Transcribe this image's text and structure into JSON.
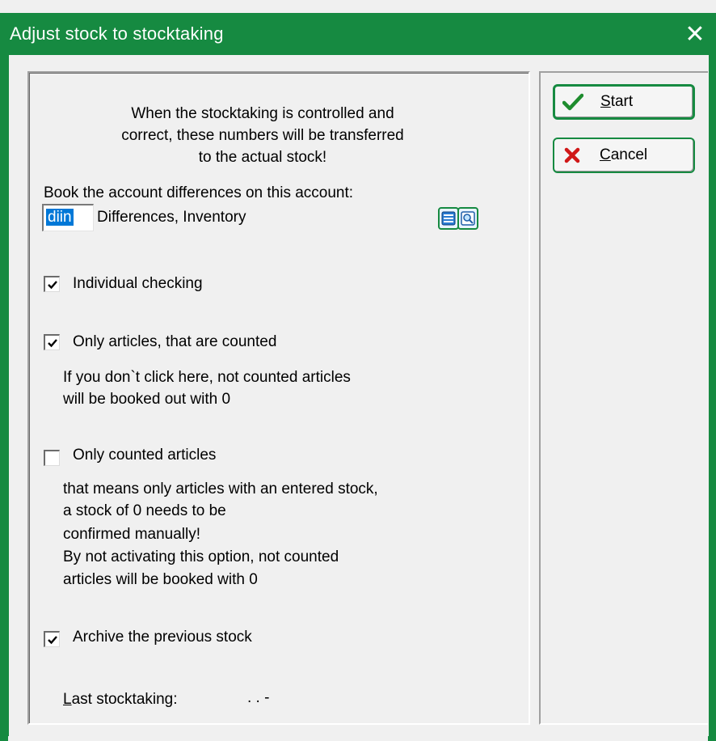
{
  "window": {
    "title": "Adjust stock to stocktaking",
    "close_glyph": "✕"
  },
  "intro": {
    "line1": "When the stocktaking is controlled and",
    "line2": "correct, these numbers will be transferred",
    "line3": "to the actual stock!"
  },
  "account": {
    "label": "Book the account differences on this account:",
    "code_value": "diin",
    "name": "Differences, Inventory",
    "icons": [
      "list-icon",
      "search-icon"
    ]
  },
  "options": {
    "individual_checking": {
      "label": "Individual checking",
      "checked": true
    },
    "only_articles_counted": {
      "label": "Only articles, that are counted",
      "checked": true,
      "hint_line1": "If you don`t click here, not counted articles",
      "hint_line2": "will be booked out with 0"
    },
    "only_counted_articles": {
      "label": "Only counted articles",
      "checked": false,
      "desc_line1": "that means only articles with an entered stock,",
      "desc_line2": "a stock of 0 needs to be",
      "desc_line3": "confirmed manually!",
      "desc_line4": "By not activating this option, not counted",
      "desc_line5": "articles will be booked with 0"
    },
    "archive_previous_stock": {
      "label": "Archive the previous stock",
      "checked": true
    }
  },
  "last_stocktaking": {
    "label_first": "L",
    "label_rest": "ast stocktaking:",
    "value": ".   .     -"
  },
  "buttons": {
    "start": {
      "label_first": "S",
      "label_rest": "tart",
      "icon": "checkmark-icon"
    },
    "cancel": {
      "label_first": "C",
      "label_rest": "ancel",
      "icon": "cross-icon"
    }
  },
  "colors": {
    "titlebar": "#168a41",
    "accent_border": "#168a41",
    "selection": "#0078d7",
    "check_green": "#1e8c2e",
    "cancel_red": "#d01818"
  }
}
